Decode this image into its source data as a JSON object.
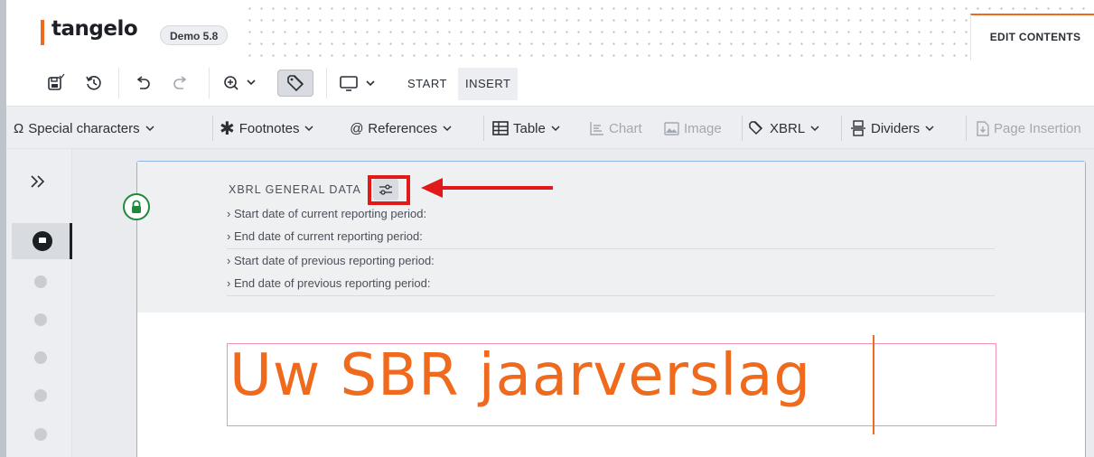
{
  "header": {
    "brand_name": "tangelo",
    "version_badge": "Demo 5.8",
    "mode_tab": "EDIT CONTENTS"
  },
  "toolbar": {
    "icons": [
      "save-icon",
      "history-icon",
      "undo-icon",
      "redo-icon",
      "zoom-icon",
      "tag-icon",
      "monitor-icon"
    ],
    "tabs": [
      {
        "label": "START",
        "selected": false
      },
      {
        "label": "INSERT",
        "selected": true
      }
    ]
  },
  "insert_toolbar": {
    "special_characters": "Special characters",
    "footnotes": "Footnotes",
    "references": "References",
    "table": "Table",
    "chart": "Chart",
    "image": "Image",
    "xbrl": "XBRL",
    "dividers": "Dividers",
    "page_insertion": "Page Insertion"
  },
  "xbrl_panel": {
    "title": "XBRL GENERAL DATA",
    "fields": [
      "› Start date of current reporting period:",
      "› End date of current reporting period:",
      "› Start date of previous reporting period:",
      "› End date of previous reporting period:"
    ]
  },
  "document": {
    "title": "Uw SBR jaarverslag"
  },
  "colors": {
    "brand": "#f06a1d",
    "highlight": "#e11919",
    "lock": "#1f8a3b"
  }
}
